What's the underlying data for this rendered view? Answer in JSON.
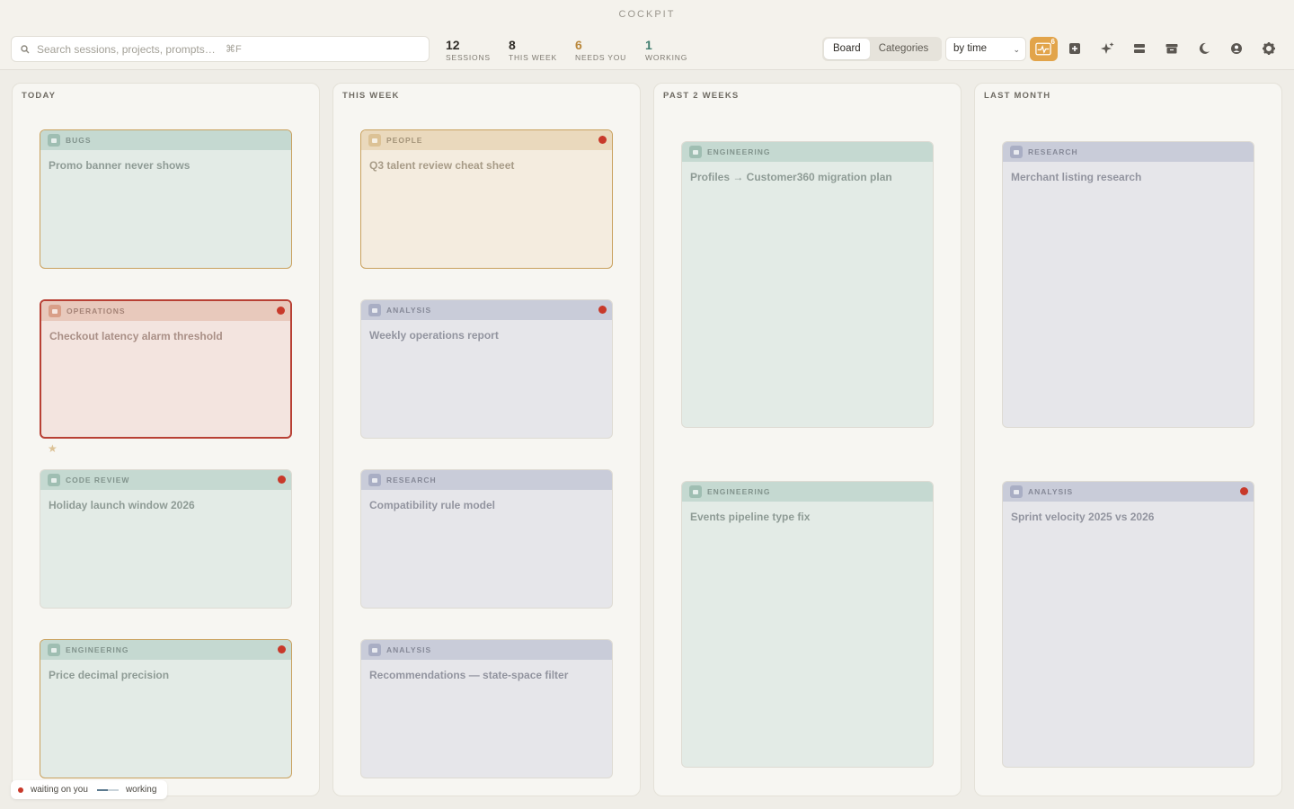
{
  "app": {
    "title": "COCKPIT"
  },
  "search": {
    "placeholder": "Search sessions, projects, prompts…",
    "shortcut": "⌘F"
  },
  "stats": [
    {
      "value": "12",
      "label": "SESSIONS",
      "color": "#2e2b26"
    },
    {
      "value": "8",
      "label": "THIS WEEK",
      "color": "#2e2b26"
    },
    {
      "value": "6",
      "label": "NEEDS YOU",
      "color": "#b9873a"
    },
    {
      "value": "1",
      "label": "WORKING",
      "color": "#3f7d6e"
    }
  ],
  "view_toggle": {
    "board": "Board",
    "categories": "Categories",
    "selected": "Board"
  },
  "sort": {
    "selected": "by time"
  },
  "activity_button": {
    "badge": "6",
    "icon": "pulse-icon"
  },
  "toolbar_icons": [
    "new-session-icon",
    "sparkle-icon",
    "stack-icon",
    "archive-icon",
    "moon-icon",
    "account-icon",
    "gear-icon"
  ],
  "columns": [
    {
      "title": "TODAY"
    },
    {
      "title": "THIS WEEK"
    },
    {
      "title": "PAST 2 WEEKS"
    },
    {
      "title": "LAST MONTH"
    }
  ],
  "cards": {
    "today": [
      {
        "category": "BUGS",
        "title": "Promo banner never shows",
        "needs_you": false,
        "working": true
      },
      {
        "category": "OPERATIONS",
        "title": "Checkout latency alarm threshold",
        "needs_you": true,
        "starred": true
      },
      {
        "category": "CODE REVIEW",
        "title": "Holiday launch window 2026",
        "needs_you": true
      },
      {
        "category": "ENGINEERING",
        "title": "Price decimal precision",
        "needs_you": true
      }
    ],
    "this_week": [
      {
        "category": "PEOPLE",
        "title": "Q3 talent review cheat sheet",
        "needs_you": true
      },
      {
        "category": "ANALYSIS",
        "title": "Weekly operations report",
        "needs_you": true
      },
      {
        "category": "RESEARCH",
        "title": "Compatibility rule model",
        "needs_you": false
      },
      {
        "category": "ANALYSIS",
        "title": "Recommendations — state-space filter",
        "needs_you": false
      }
    ],
    "past_2_weeks": [
      {
        "category": "ENGINEERING",
        "title": "Profiles → Customer360 migration plan",
        "needs_you": false
      },
      {
        "category": "ENGINEERING",
        "title": "Events pipeline type fix",
        "needs_you": false
      }
    ],
    "last_month": [
      {
        "category": "RESEARCH",
        "title": "Merchant listing research",
        "needs_you": false
      },
      {
        "category": "ANALYSIS",
        "title": "Sprint velocity 2025 vs 2026",
        "needs_you": true
      }
    ]
  },
  "legend": {
    "waiting": "waiting on you",
    "working": "working"
  },
  "colors": {
    "accent": "#e2a44a",
    "alert": "#c8392a",
    "engineering": "#c5d9d1",
    "people": "#ead9bd",
    "operations": "#e8c9bc",
    "analysis": "#c9ccd9"
  }
}
